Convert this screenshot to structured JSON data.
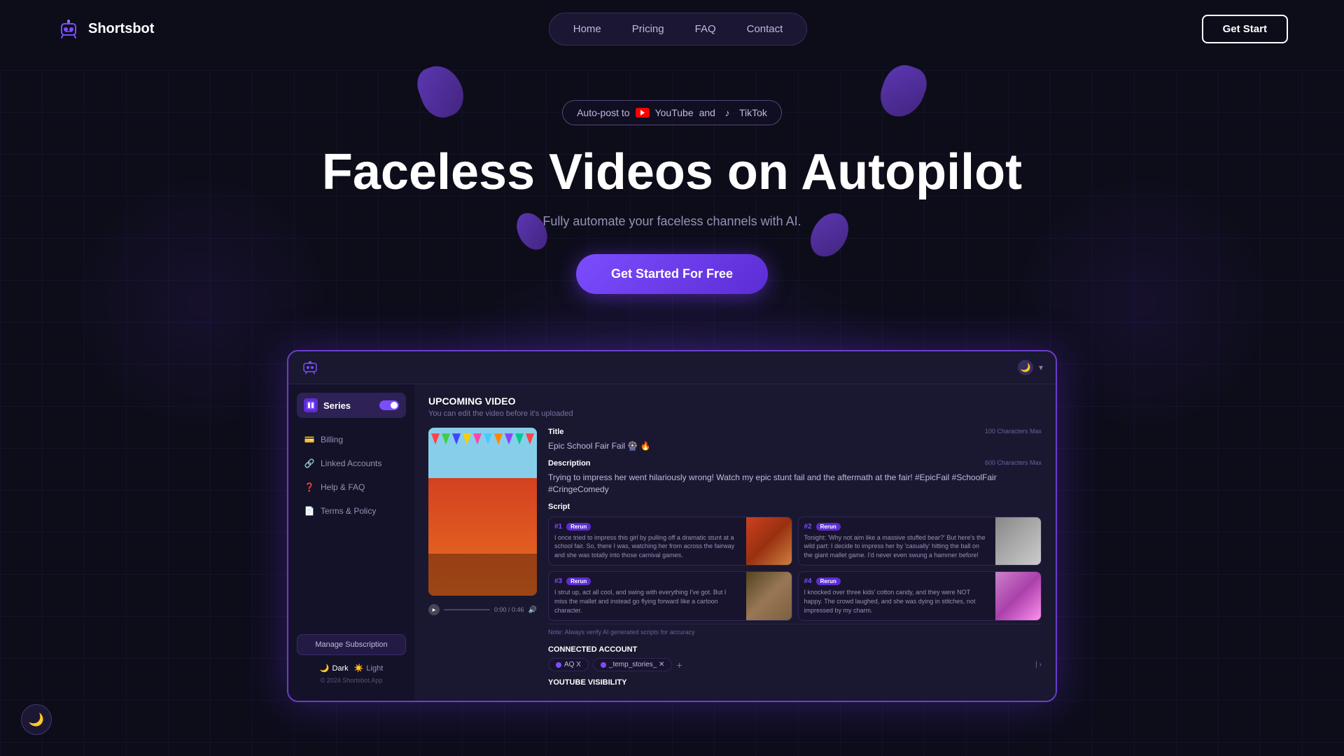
{
  "brand": {
    "name": "Shortsbot",
    "logo_alt": "robot icon"
  },
  "nav": {
    "links": [
      {
        "label": "Home",
        "id": "home"
      },
      {
        "label": "Pricing",
        "id": "pricing"
      },
      {
        "label": "FAQ",
        "id": "faq"
      },
      {
        "label": "Contact",
        "id": "contact"
      }
    ],
    "cta_label": "Get Start"
  },
  "hero": {
    "badge_text": "Auto-post to",
    "badge_yt": "YouTube",
    "badge_and": "and",
    "badge_tt": "TikTok",
    "title": "Faceless Videos on Autopilot",
    "subtitle": "Fully automate your faceless channels with AI.",
    "cta_label": "Get Started For Free"
  },
  "app_preview": {
    "topbar": {
      "logo_alt": "app robot icon"
    },
    "sidebar": {
      "series_label": "Series",
      "items": [
        {
          "label": "Billing",
          "icon": "💳"
        },
        {
          "label": "Linked Accounts",
          "icon": "🔗"
        },
        {
          "label": "Help & FAQ",
          "icon": "❓"
        },
        {
          "label": "Terms & Policy",
          "icon": "📄"
        }
      ],
      "manage_sub": "Manage Subscription",
      "theme_dark": "Dark",
      "theme_light": "Light",
      "footer": "© 2024 Shortsbot.App"
    },
    "main": {
      "upcoming_title": "UPCOMING VIDEO",
      "upcoming_sub": "You can edit the video before it's uploaded",
      "title_label": "Title",
      "title_char_max": "100 Characters Max",
      "title_value": "Epic School Fair Fail 🎡 🔥",
      "desc_label": "Description",
      "desc_char_max": "600 Characters Max",
      "desc_value": "Trying to impress her went hilariously wrong! Watch my epic stunt fail and the aftermath at the fair! #EpicFail #SchoolFair #CringeComedy",
      "script_label": "Script",
      "scripts": [
        {
          "num": "#1",
          "badge": "Rerun",
          "text": "I once tried to impress this girl by pulling off a dramatic stunt at a school fair. So, there I was, watching her from across the fairway and she was totally into those carnival games."
        },
        {
          "num": "#2",
          "badge": "Rerun",
          "text": "Tonight: 'Why not aim like a massive stuffed bear?' But here's the wild part: I decide to impress her by 'casually' hitting the ball on the giant mallet game. I'd never even swung a hammer before!"
        },
        {
          "num": "#3",
          "badge": "Rerun",
          "text": "I strut up, act all cool, and swing with everything I've got. But I miss the mallet and instead go flying forward like a cartoon character."
        },
        {
          "num": "#4",
          "badge": "Rerun",
          "text": "I knocked over three kids' cotton candy, and they were NOT happy. The crowd laughed, and she was dying in stitches, not impressed by my charm."
        }
      ],
      "ai_note": "Note: Always verify AI generated scripts for accuracy",
      "connected_label": "CONNECTED ACCOUNT",
      "accounts": [
        "AQ X",
        "_temp_stories_ ✕"
      ],
      "add_icon": "+",
      "yt_visibility": "YOUTUBE VISIBILITY",
      "video_time": "0:00 / 0:46"
    }
  },
  "dark_toggle": "🌙"
}
